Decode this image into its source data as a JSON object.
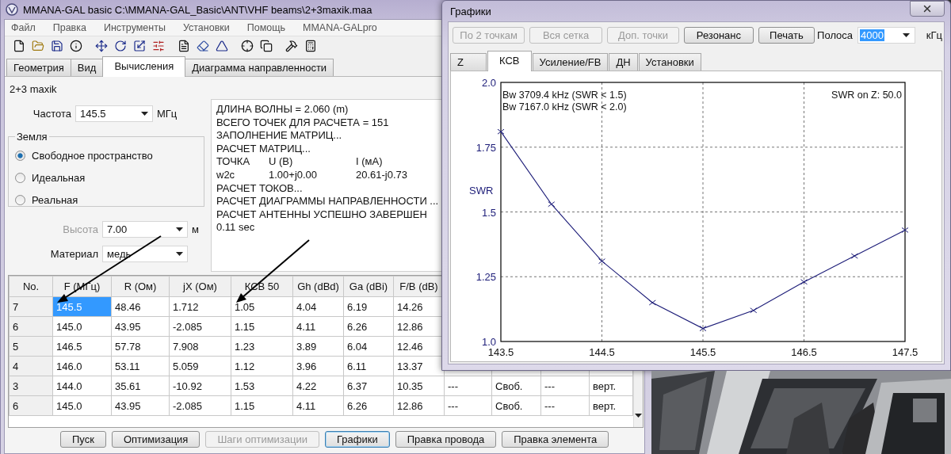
{
  "main_window": {
    "title": "MMANA-GAL basic C:\\MMANA-GAL_Basic\\ANT\\VHF beams\\2+3maxik.maa",
    "menu": [
      "Файл",
      "Правка",
      "Инструменты",
      "Установки",
      "Помощь",
      "MMANA-GALpro"
    ],
    "tabs": [
      {
        "label": "Геометрия",
        "selected": false
      },
      {
        "label": "Вид",
        "selected": false
      },
      {
        "label": "Вычисления",
        "selected": true
      },
      {
        "label": "Диаграмма направленности",
        "selected": false
      }
    ],
    "antenna_name": "2+3 maxik",
    "frequency": {
      "label": "Частота",
      "value": "145.5",
      "unit": "МГц"
    },
    "ground": {
      "title": "Земля",
      "options": [
        {
          "label": "Свободное пространство",
          "selected": true
        },
        {
          "label": "Идеальная",
          "selected": false
        },
        {
          "label": "Реальная",
          "selected": false
        }
      ]
    },
    "height": {
      "label": "Высота",
      "value": "7.00",
      "unit": "м",
      "disabled": true
    },
    "material": {
      "label": "Материал",
      "value": "медь"
    },
    "log": [
      {
        "kind": "text",
        "text": "ДЛИНА ВОЛНЫ = 2.060 (m)"
      },
      {
        "kind": "text",
        "text": "ВСЕГО ТОЧЕК ДЛЯ РАСЧЕТА = 151"
      },
      {
        "kind": "text",
        "text": "ЗАПОЛНЕНИЕ МАТРИЦ..."
      },
      {
        "kind": "text",
        "text": "РАСЧЕТ МАТРИЦ..."
      },
      {
        "kind": "columns",
        "cells": [
          "ТОЧКА",
          "U (B)",
          "I (мА)"
        ]
      },
      {
        "kind": "columns",
        "cells": [
          "w2c",
          "1.00+j0.00",
          "20.61-j0.73"
        ]
      },
      {
        "kind": "text",
        "text": "РАСЧЕТ ТОКОВ..."
      },
      {
        "kind": "text",
        "text": "РАСЧЕТ ДИАГРАММЫ НАПРАВЛЕННОСТИ ..."
      },
      {
        "kind": "text",
        "text": "РАСЧЕТ АНТЕННЫ УСПЕШНО ЗАВЕРШЕН"
      },
      {
        "kind": "text",
        "text": "0.11 sec"
      }
    ],
    "table": {
      "columns": [
        "No.",
        "F (МГц)",
        "R (Ом)",
        "jX (Ом)",
        "КСВ 50",
        "Gh (dBd)",
        "Ga (dBi)",
        "F/B (dB)"
      ],
      "rows": [
        {
          "cells": [
            {
              "text": "7",
              "selected": false
            },
            {
              "text": "145.5",
              "selected": true
            },
            {
              "text": "48.46",
              "selected": false
            },
            {
              "text": "1.712",
              "selected": false
            },
            {
              "text": "1.05",
              "selected": false
            },
            {
              "text": "4.04",
              "selected": false
            },
            {
              "text": "6.19",
              "selected": false
            },
            {
              "text": "14.26",
              "selected": false
            }
          ]
        },
        {
          "cells": [
            {
              "text": "6",
              "selected": false
            },
            {
              "text": "145.0",
              "selected": false
            },
            {
              "text": "43.95",
              "selected": false
            },
            {
              "text": "-2.085",
              "selected": false
            },
            {
              "text": "1.15",
              "selected": false
            },
            {
              "text": "4.11",
              "selected": false
            },
            {
              "text": "6.26",
              "selected": false
            },
            {
              "text": "12.86",
              "selected": false
            }
          ]
        },
        {
          "cells": [
            {
              "text": "5",
              "selected": false
            },
            {
              "text": "146.5",
              "selected": false
            },
            {
              "text": "57.78",
              "selected": false
            },
            {
              "text": "7.908",
              "selected": false
            },
            {
              "text": "1.23",
              "selected": false
            },
            {
              "text": "3.89",
              "selected": false
            },
            {
              "text": "6.04",
              "selected": false
            },
            {
              "text": "12.46",
              "selected": false
            }
          ]
        },
        {
          "cells": [
            {
              "text": "4",
              "selected": false
            },
            {
              "text": "146.0",
              "selected": false
            },
            {
              "text": "53.11",
              "selected": false
            },
            {
              "text": "5.059",
              "selected": false
            },
            {
              "text": "1.12",
              "selected": false
            },
            {
              "text": "3.96",
              "selected": false
            },
            {
              "text": "6.11",
              "selected": false
            },
            {
              "text": "13.37",
              "selected": false
            }
          ]
        },
        {
          "cells": [
            {
              "text": "3",
              "selected": false
            },
            {
              "text": "144.0",
              "selected": false
            },
            {
              "text": "35.61",
              "selected": false
            },
            {
              "text": "-10.92",
              "selected": false
            },
            {
              "text": "1.53",
              "selected": false
            },
            {
              "text": "4.22",
              "selected": false
            },
            {
              "text": "6.37",
              "selected": false
            },
            {
              "text": "10.35",
              "selected": false
            },
            {
              "text": "---",
              "selected": false
            },
            {
              "text": "Своб.",
              "selected": false
            },
            {
              "text": "---",
              "selected": false
            },
            {
              "text": "верт.",
              "selected": false
            }
          ]
        },
        {
          "cells": [
            {
              "text": "6",
              "selected": false
            },
            {
              "text": "145.0",
              "selected": false
            },
            {
              "text": "43.95",
              "selected": false
            },
            {
              "text": "-2.085",
              "selected": false
            },
            {
              "text": "1.15",
              "selected": false
            },
            {
              "text": "4.11",
              "selected": false
            },
            {
              "text": "6.26",
              "selected": false
            },
            {
              "text": "12.86",
              "selected": false
            },
            {
              "text": "---",
              "selected": false
            },
            {
              "text": "Своб.",
              "selected": false
            },
            {
              "text": "---",
              "selected": false
            },
            {
              "text": "верт.",
              "selected": false
            }
          ]
        }
      ]
    },
    "buttons": [
      {
        "label": "Пуск",
        "disabled": false,
        "focused": false
      },
      {
        "label": "Оптимизация",
        "disabled": false,
        "focused": false
      },
      {
        "label": "Шаги оптимизации",
        "disabled": true,
        "focused": false
      },
      {
        "label": "Графики",
        "disabled": false,
        "focused": true
      },
      {
        "label": "Правка провода",
        "disabled": false,
        "focused": false
      },
      {
        "label": "Правка элемента",
        "disabled": false,
        "focused": false
      }
    ]
  },
  "graph_window": {
    "title": "Графики",
    "toolbar": [
      {
        "label": "По 2 точкам",
        "disabled": true
      },
      {
        "label": "Вся сетка",
        "disabled": true
      },
      {
        "label": "Доп. точки",
        "disabled": true
      },
      {
        "label": "Резонанс",
        "disabled": false
      },
      {
        "label": "Печать",
        "disabled": false
      }
    ],
    "band": {
      "label": "Полоса",
      "value": "4000",
      "unit": "кГц"
    },
    "tabs": [
      {
        "label": "Z",
        "selected": false
      },
      {
        "label": "КСВ",
        "selected": true
      },
      {
        "label": "Усиление/FB",
        "selected": false
      },
      {
        "label": "ДН",
        "selected": false
      },
      {
        "label": "Установки",
        "selected": false
      }
    ],
    "notes": [
      "Bw 3709.4 kHz (SWR < 1.5)",
      "Bw 7167.0 kHz (SWR < 2.0)"
    ],
    "impedance_note": "SWR on Z: 50.0",
    "chart_data": {
      "type": "line",
      "ylabel": "SWR",
      "x": [
        143.5,
        144.0,
        144.5,
        145.0,
        145.5,
        146.0,
        146.5,
        147.0,
        147.5
      ],
      "series": [
        {
          "color": "#1c1c78",
          "marker": "x",
          "values": [
            1.81,
            1.53,
            1.31,
            1.15,
            1.05,
            1.12,
            1.23,
            1.33,
            1.43
          ]
        }
      ],
      "grid": true,
      "xlim": [
        143.5,
        147.5
      ],
      "ylim": [
        1.0,
        2.0
      ],
      "xticks": [
        143.5,
        144.5,
        145.5,
        146.5,
        147.5
      ],
      "yticks": [
        {
          "value": 1.0,
          "label": "1.0"
        },
        {
          "value": 1.25,
          "label": "1.25"
        },
        {
          "value": 1.5,
          "label": "1.5"
        },
        {
          "value": 1.75,
          "label": "1.75"
        },
        {
          "value": 2.0,
          "label": "2.0"
        }
      ]
    }
  }
}
